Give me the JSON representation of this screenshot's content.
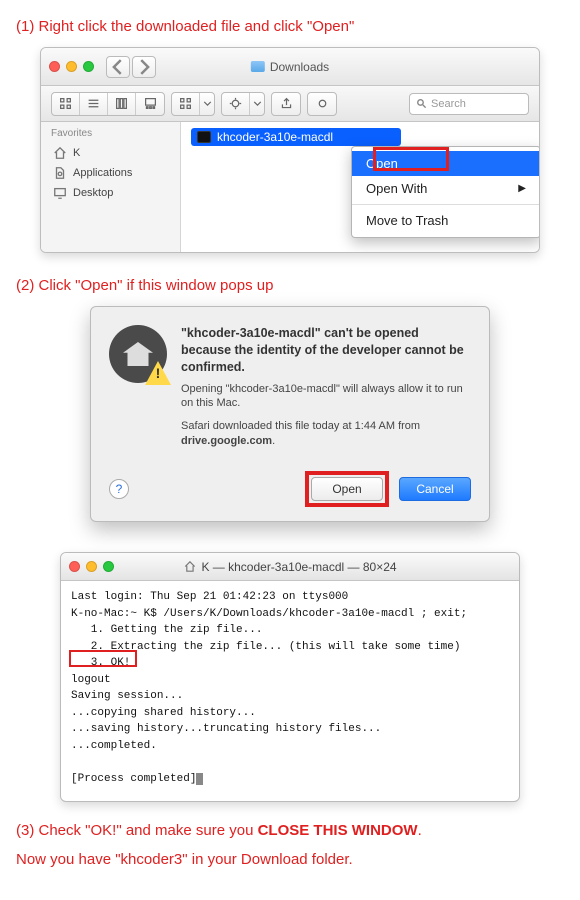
{
  "instructions": {
    "step1": "(1) Right click the downloaded file and click \"Open\"",
    "step2": "(2) Click \"Open\" if this window pops up",
    "step3_a": "(3) Check \"OK!\" and make sure you ",
    "step3_b": "CLOSE THIS WINDOW",
    "step3_c": ".",
    "step4": "Now you have \"khcoder3\" in your Download folder."
  },
  "finder": {
    "title": "Downloads",
    "search_placeholder": "Search",
    "sidebar": {
      "heading": "Favorites",
      "items": [
        {
          "label": "K"
        },
        {
          "label": "Applications"
        },
        {
          "label": "Desktop"
        }
      ]
    },
    "file": "khcoder-3a10e-macdl",
    "context_menu": {
      "items": [
        {
          "label": "Open",
          "highlighted": true
        },
        {
          "label": "Open With",
          "submenu": true
        },
        {
          "label": "Move to Trash"
        }
      ]
    }
  },
  "dialog": {
    "title": "\"khcoder-3a10e-macdl\" can't be opened because the identity of the developer cannot be confirmed.",
    "line1": "Opening \"khcoder-3a10e-macdl\" will always allow it to run on this Mac.",
    "line2_a": "Safari downloaded this file today at 1:44 AM from ",
    "line2_b": "drive.google.com",
    "line2_c": ".",
    "help": "?",
    "open": "Open",
    "cancel": "Cancel"
  },
  "terminal": {
    "title": "K — khcoder-3a10e-macdl — 80×24",
    "lines": {
      "l0": "Last login: Thu Sep 21 01:42:23 on ttys000",
      "l1": "K-no-Mac:~ K$ /Users/K/Downloads/khcoder-3a10e-macdl ; exit;",
      "l2": "   1. Getting the zip file...",
      "l3": "   2. Extracting the zip file... (this will take some time)",
      "l4": "   3. OK!",
      "l5": "logout",
      "l6": "Saving session...",
      "l7": "...copying shared history...",
      "l8": "...saving history...truncating history files...",
      "l9": "...completed.",
      "l10": "",
      "l11": "[Process completed]"
    }
  }
}
